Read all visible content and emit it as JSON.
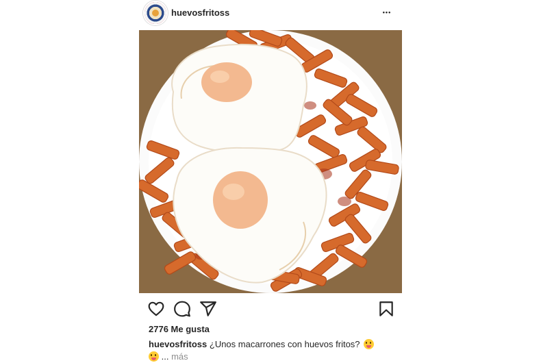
{
  "post": {
    "username": "huevosfritoss",
    "more_icon": "ellipsis-icon",
    "more_glyph": "•••",
    "likes_label": "2776 Me gusta",
    "caption_user": "huevosfritoss",
    "caption_text": "¿Unos macarrones con huevos fritos?",
    "caption_ellipsis": "...",
    "caption_more": "más"
  },
  "actions": {
    "icons": [
      "heart-icon",
      "comment-icon",
      "share-icon",
      "bookmark-icon"
    ]
  },
  "colors": {
    "text": "#262626",
    "muted": "#8e8e8e",
    "plate": "#ffffff",
    "table": "#8a6a44",
    "pasta": "#d9682a",
    "yolk": "#f3b990"
  }
}
